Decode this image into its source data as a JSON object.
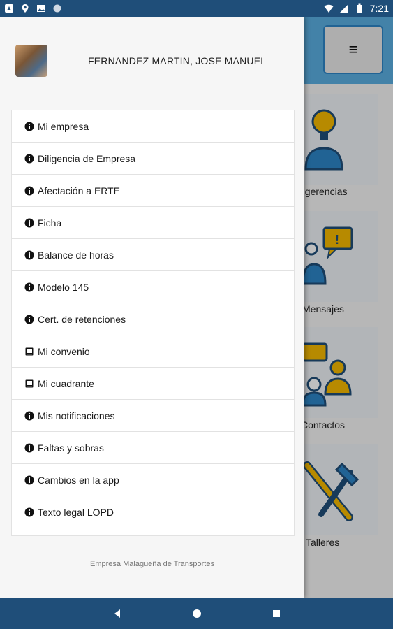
{
  "status_bar": {
    "time": "7:21",
    "left_icons": [
      "notification-icon",
      "location-icon",
      "image-icon",
      "circle-icon"
    ],
    "right_icons": [
      "wifi-icon",
      "signal-icon",
      "battery-icon"
    ]
  },
  "background_app": {
    "menu_button_label": "≡",
    "tiles": [
      {
        "label": "ugerencias",
        "icon": "lightbulb-person-icon"
      },
      {
        "label": "Mensajes",
        "icon": "message-person-icon"
      },
      {
        "label": "Contactos",
        "icon": "contacts-icon"
      },
      {
        "label": "Talleres",
        "icon": "tools-icon"
      }
    ]
  },
  "drawer": {
    "user": {
      "name": "FERNANDEZ MARTIN, JOSE MANUEL"
    },
    "menu_items": [
      {
        "label": "Mi empresa",
        "icon": "info-icon"
      },
      {
        "label": "Diligencia de Empresa",
        "icon": "info-icon"
      },
      {
        "label": "Afectación a ERTE",
        "icon": "info-icon"
      },
      {
        "label": "Ficha",
        "icon": "info-icon"
      },
      {
        "label": "Balance de horas",
        "icon": "info-icon"
      },
      {
        "label": "Modelo 145",
        "icon": "info-icon"
      },
      {
        "label": "Cert. de retenciones",
        "icon": "info-icon"
      },
      {
        "label": "Mi convenio",
        "icon": "book-icon"
      },
      {
        "label": "Mi cuadrante",
        "icon": "book-icon"
      },
      {
        "label": "Mis notificaciones",
        "icon": "info-icon"
      },
      {
        "label": "Faltas y sobras",
        "icon": "info-icon"
      },
      {
        "label": "Cambios en la app",
        "icon": "info-icon"
      },
      {
        "label": "Texto legal LOPD",
        "icon": "info-icon"
      }
    ],
    "footer": "Empresa Malagueña de Transportes"
  },
  "nav_bar": {
    "buttons": [
      "back-icon",
      "home-icon",
      "recents-icon"
    ]
  },
  "colors": {
    "status_bar": "#1f4e79",
    "header_blue": "#5aaee0",
    "accent_yellow": "#f5b800",
    "accent_blue": "#2d84c6"
  }
}
